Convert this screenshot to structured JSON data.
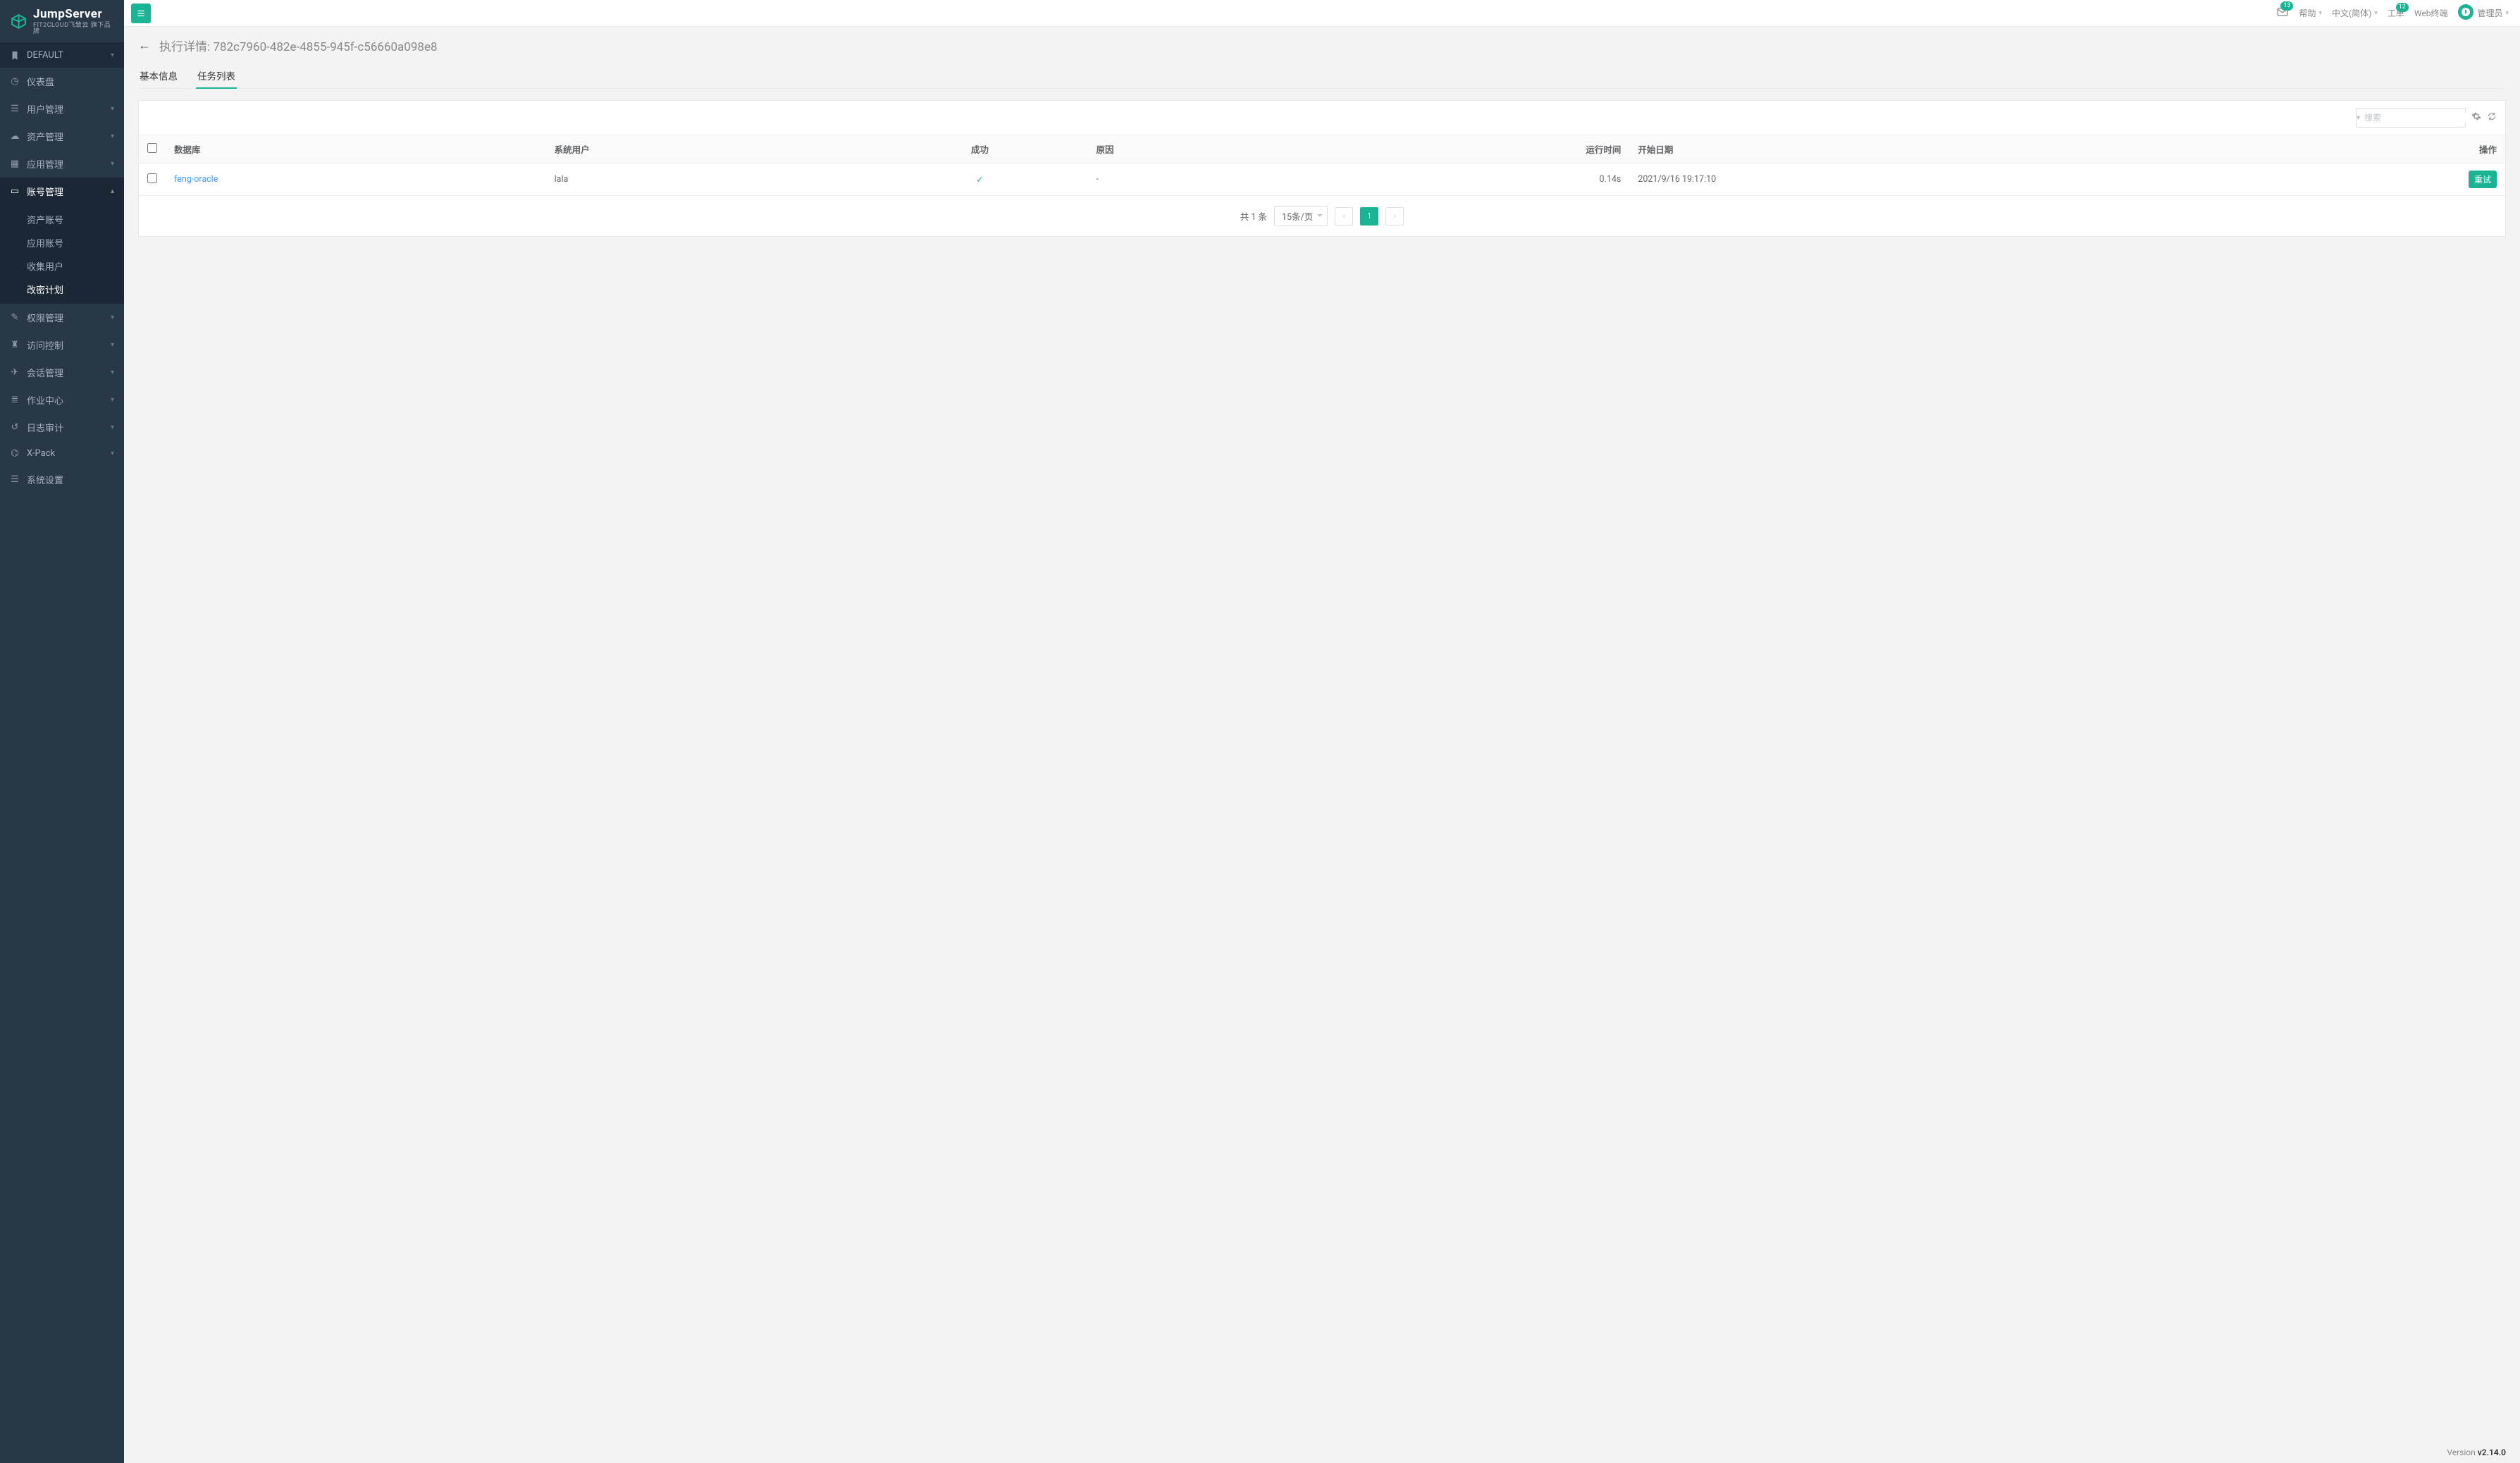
{
  "brand": {
    "title": "JumpServer",
    "subtitle": "FIT2CLOUD飞致云 旗下品牌"
  },
  "topbar": {
    "mail_badge": "13",
    "help": "帮助",
    "language": "中文(简体)",
    "ticket": "工单",
    "ticket_badge": "12",
    "web_terminal": "Web终端",
    "admin": "管理员"
  },
  "sidebar": {
    "default": "DEFAULT",
    "items": [
      {
        "icon": "dashboard",
        "label": "仪表盘",
        "chev": false
      },
      {
        "icon": "users",
        "label": "用户管理",
        "chev": true
      },
      {
        "icon": "assets",
        "label": "资产管理",
        "chev": true
      },
      {
        "icon": "apps",
        "label": "应用管理",
        "chev": true
      }
    ],
    "account_mgmt": "账号管理",
    "submenu": [
      "资产账号",
      "应用账号",
      "收集用户",
      "改密计划"
    ],
    "items_after": [
      {
        "icon": "perm",
        "label": "权限管理",
        "chev": true
      },
      {
        "icon": "acl",
        "label": "访问控制",
        "chev": true
      },
      {
        "icon": "session",
        "label": "会话管理",
        "chev": true
      },
      {
        "icon": "jobs",
        "label": "作业中心",
        "chev": true
      },
      {
        "icon": "audit",
        "label": "日志审计",
        "chev": true
      },
      {
        "icon": "xpack",
        "label": "X-Pack",
        "chev": true
      },
      {
        "icon": "settings",
        "label": "系统设置",
        "chev": false
      }
    ]
  },
  "page": {
    "title_prefix": "执行详情: ",
    "title_id": "782c7960-482e-4855-945f-c56660a098e8",
    "tabs": [
      "基本信息",
      "任务列表"
    ],
    "active_tab": 1
  },
  "toolbar": {
    "search_placeholder": "搜索"
  },
  "table": {
    "headers": {
      "database": "数据库",
      "sysuser": "系统用户",
      "success": "成功",
      "reason": "原因",
      "runtime": "运行时间",
      "startdate": "开始日期",
      "action": "操作"
    },
    "rows": [
      {
        "database": "feng-oracle",
        "sysuser": "lala",
        "success": true,
        "reason": "-",
        "runtime": "0.14s",
        "startdate": "2021/9/16 19:17:10",
        "action": "重试"
      }
    ]
  },
  "pagination": {
    "total": "共 1 条",
    "per_page": "15条/页",
    "current": "1"
  },
  "footer": {
    "label": "Version ",
    "version": "v2.14.0"
  }
}
